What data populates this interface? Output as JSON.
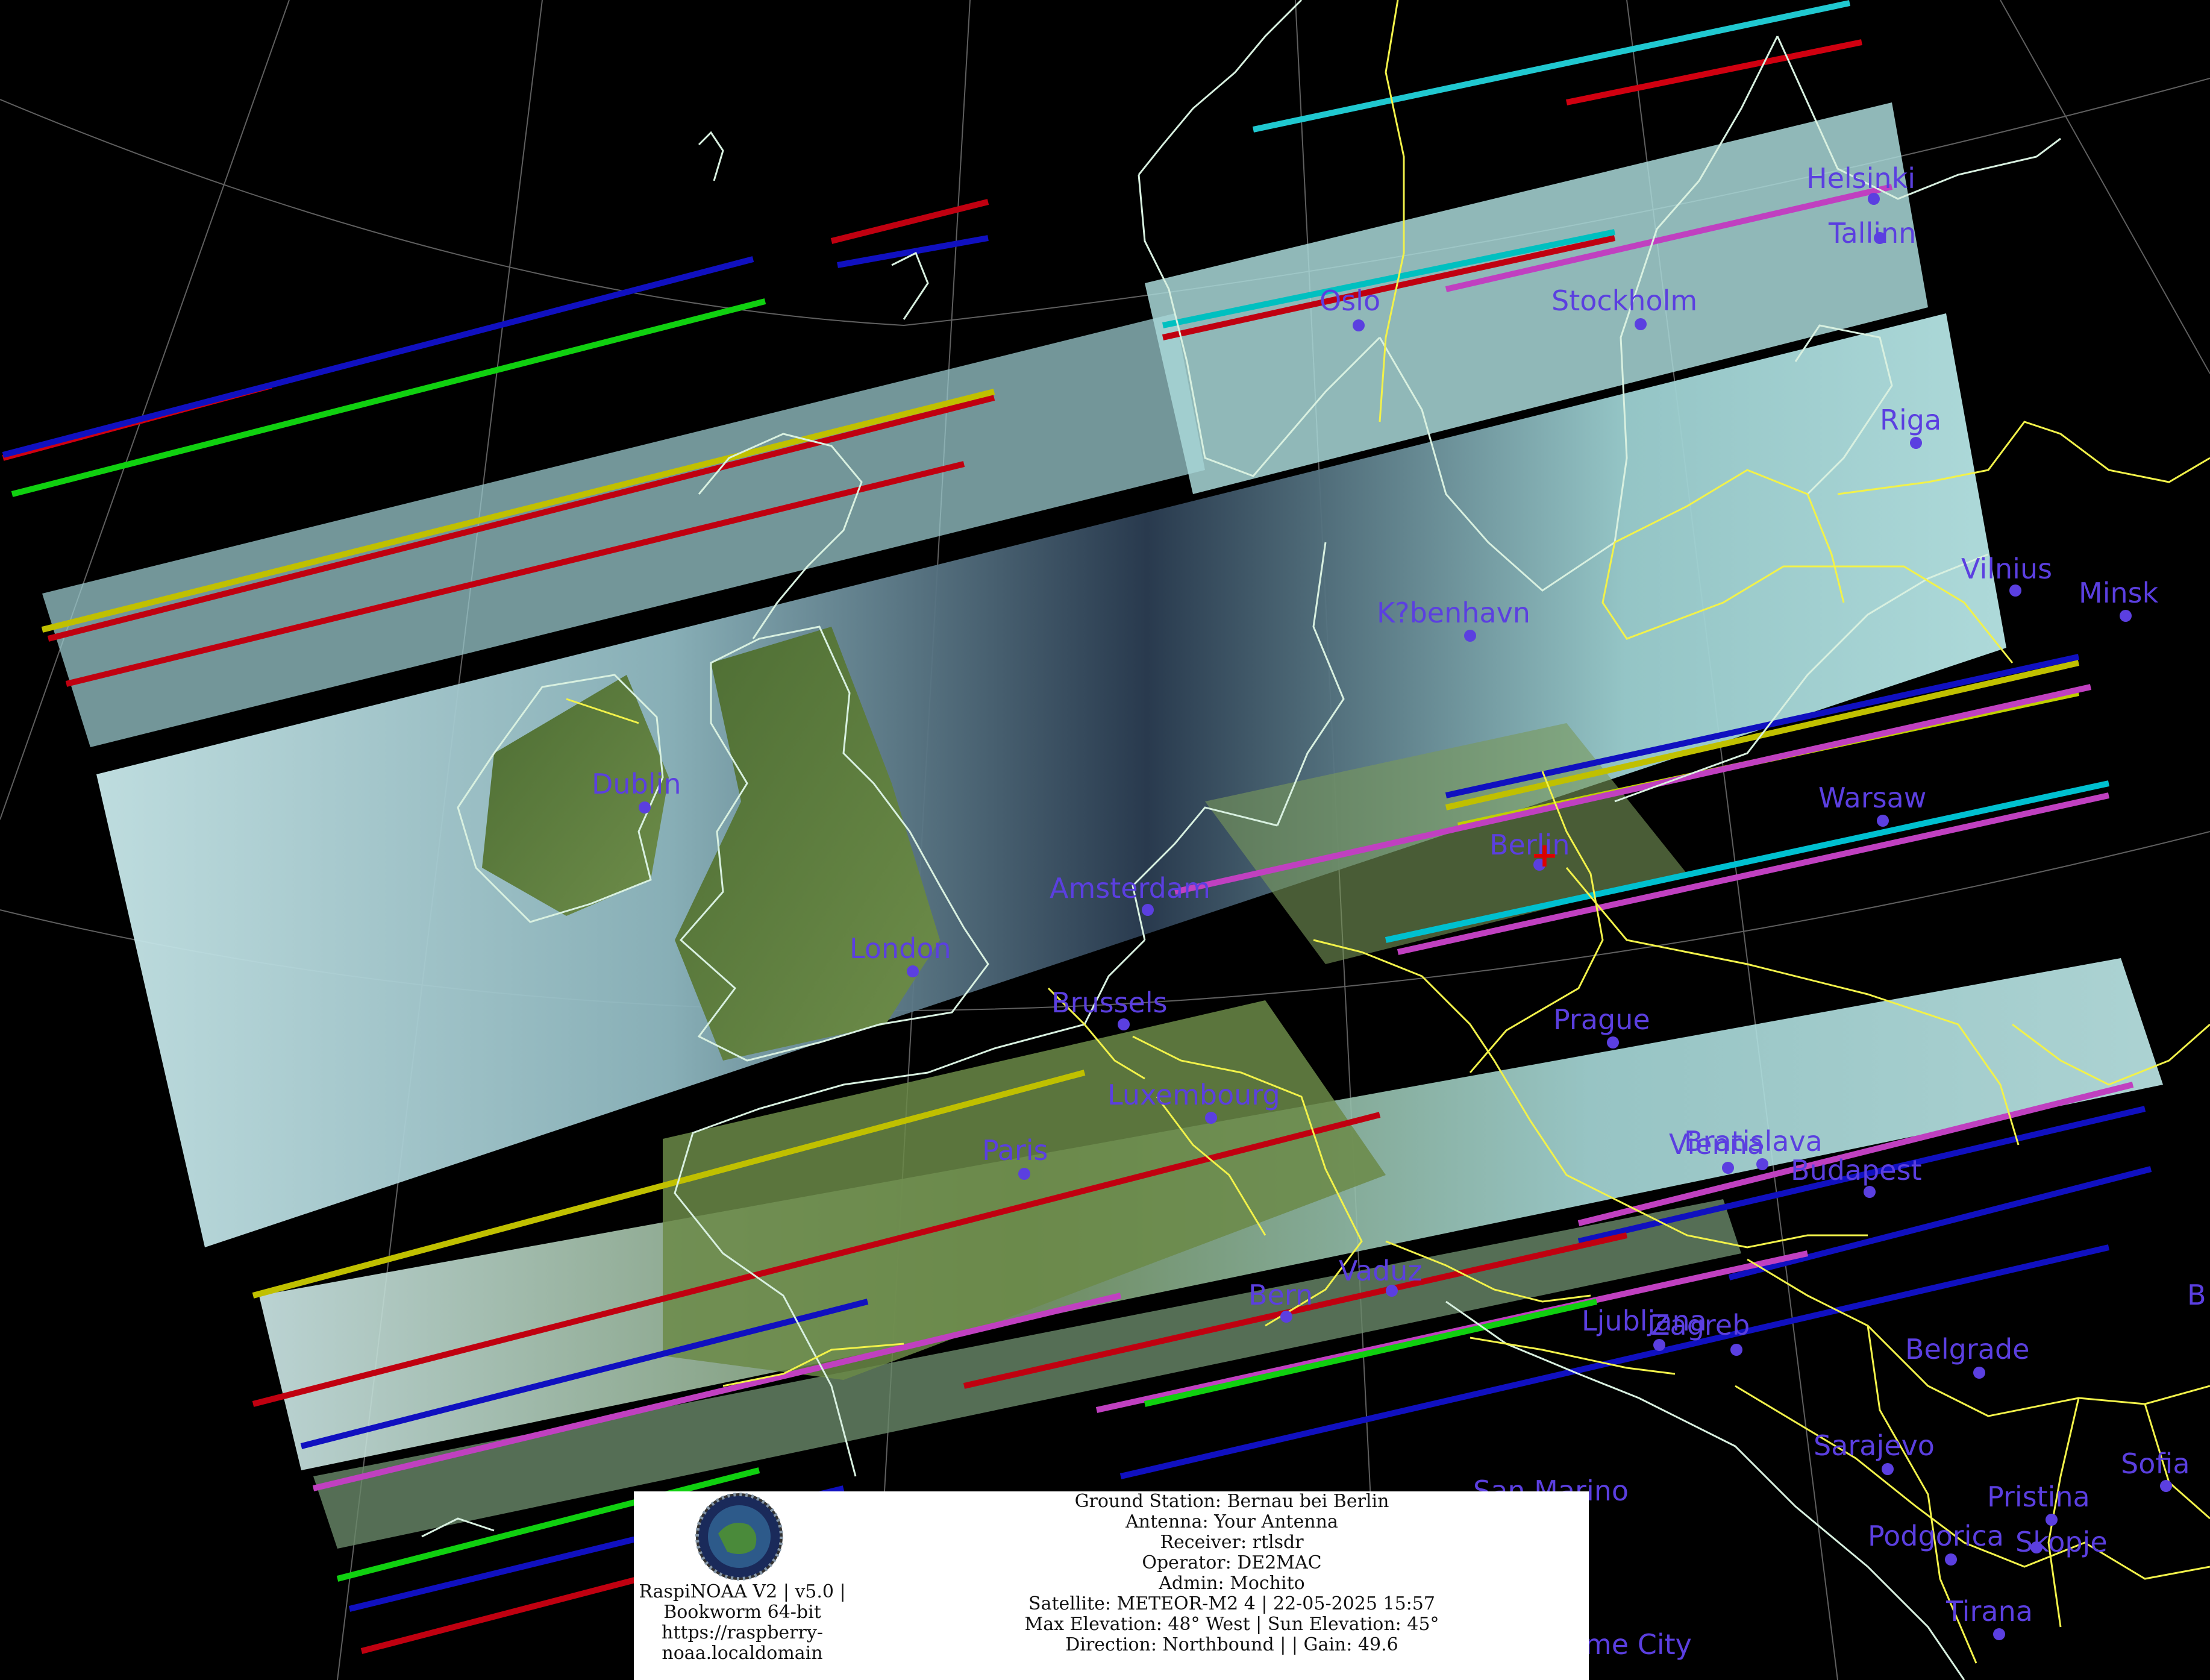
{
  "cities": [
    {
      "name": "Helsinki"
    },
    {
      "name": "Tallinn"
    },
    {
      "name": "Oslo"
    },
    {
      "name": "Stockholm"
    },
    {
      "name": "Riga"
    },
    {
      "name": "Vilnius"
    },
    {
      "name": "Minsk"
    },
    {
      "name": "K?benhavn"
    },
    {
      "name": "Dublin"
    },
    {
      "name": "Warsaw"
    },
    {
      "name": "Berlin"
    },
    {
      "name": "Amsterdam"
    },
    {
      "name": "London"
    },
    {
      "name": "Brussels"
    },
    {
      "name": "Prague"
    },
    {
      "name": "Luxembourg"
    },
    {
      "name": "Paris"
    },
    {
      "name": "Vienna"
    },
    {
      "name": "Bratislava"
    },
    {
      "name": "Budapest"
    },
    {
      "name": "Bern"
    },
    {
      "name": "Vaduz"
    },
    {
      "name": "Ljubljana"
    },
    {
      "name": "Zagreb"
    },
    {
      "name": "Belgrade"
    },
    {
      "name": "Sarajevo"
    },
    {
      "name": "Sofia"
    },
    {
      "name": "San Marino"
    },
    {
      "name": "Pristina"
    },
    {
      "name": "Podgorica"
    },
    {
      "name": "Skopje"
    },
    {
      "name": "Tirana"
    },
    {
      "name": "me City"
    },
    {
      "name": "B"
    }
  ],
  "station_marker": "+",
  "info": {
    "software_lines": [
      "RaspiNOAA V2 | v5.0 |",
      "Bookworm 64-bit",
      "https://raspberry-",
      "noaa.localdomain"
    ],
    "pass_lines": [
      "Ground Station: Bernau bei Berlin",
      "Antenna: Your Antenna",
      "Receiver: rtlsdr",
      "Operator: DE2MAC",
      "Admin: Mochito",
      "Satellite: METEOR-M2 4 | 22-05-2025 15:57",
      "Max Elevation: 48° West | Sun Elevation: 45°",
      "Direction: Northbound | | Gain: 49.6"
    ]
  },
  "colors": {
    "background": "#000000",
    "coastline": "#d8f0e0",
    "border": "#f2f24a",
    "city": "#5b3fe0",
    "station": "#dd0000",
    "cloud": "#a8d8d8",
    "land": "#5a7a3a",
    "sea": "#1a2a3a"
  }
}
